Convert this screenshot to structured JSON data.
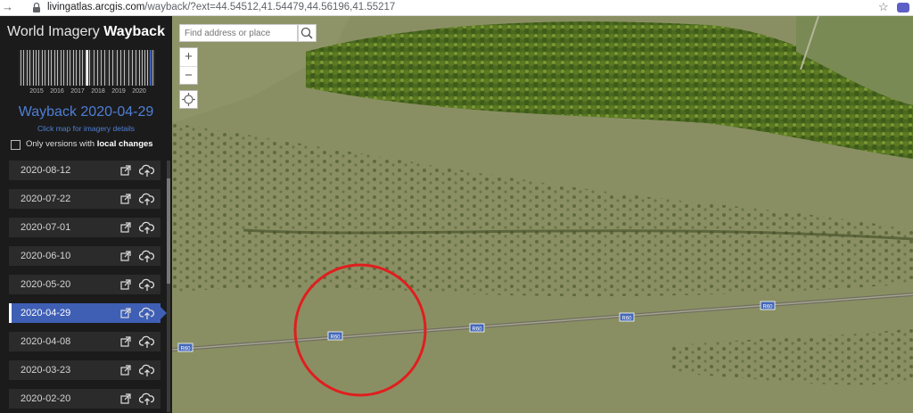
{
  "browser": {
    "url_host": "livingatlas.arcgis.com",
    "url_path": "/wayback/?ext=44.54512,41.54479,44.56196,41.55217"
  },
  "sidebar": {
    "title_prefix": "World Imagery",
    "title_bold": "Wayback",
    "timeline_years": [
      "2015",
      "2016",
      "2017",
      "2018",
      "2019",
      "2020"
    ],
    "selected_release": "Wayback 2020-04-29",
    "hint": "Click map for imagery details",
    "local_changes_prefix": "Only versions with",
    "local_changes_bold": "local changes",
    "local_changes_checked": false,
    "releases": [
      {
        "date": "2020-08-12",
        "active": false
      },
      {
        "date": "2020-07-22",
        "active": false
      },
      {
        "date": "2020-07-01",
        "active": false
      },
      {
        "date": "2020-06-10",
        "active": false
      },
      {
        "date": "2020-05-20",
        "active": false
      },
      {
        "date": "2020-04-29",
        "active": true
      },
      {
        "date": "2020-04-08",
        "active": false
      },
      {
        "date": "2020-03-23",
        "active": false
      },
      {
        "date": "2020-02-20",
        "active": false
      }
    ],
    "accent_color": "#3f5fb5"
  },
  "map": {
    "search_placeholder": "Find address or place",
    "zoom_in": "+",
    "zoom_out": "−",
    "road_labels": [
      "R60",
      "R60",
      "R60",
      "R60",
      "R60"
    ],
    "annotation_color": "#e01e1e"
  }
}
